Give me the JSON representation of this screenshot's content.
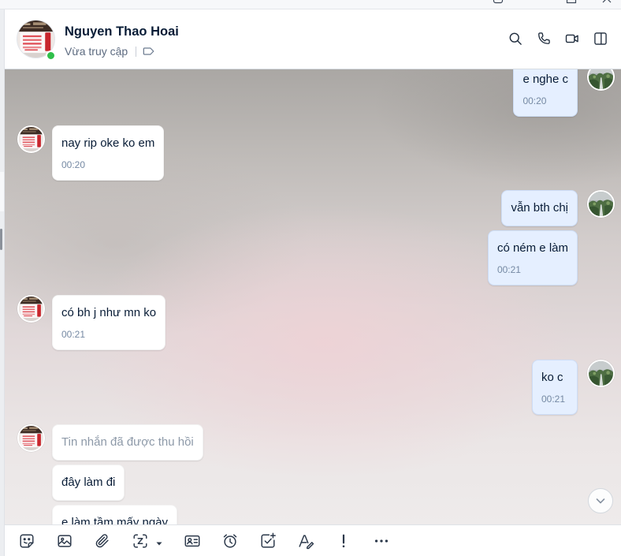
{
  "window": {
    "controls": [
      "window-icon",
      "maximize-icon",
      "close-icon"
    ]
  },
  "header": {
    "name": "Nguyen Thao Hoai",
    "status": "Vừa truy cập",
    "online": true,
    "label_icon": "tag-icon",
    "actions": [
      "search-icon",
      "phone-icon",
      "video-call-icon",
      "sidebar-toggle-icon"
    ]
  },
  "messages": [
    {
      "outgoing": true,
      "text": "e nghe c",
      "time": "00:20"
    },
    {
      "outgoing": false,
      "text": "nay rip oke ko em",
      "time": "00:20"
    },
    {
      "outgoing": true,
      "text": "vẫn bth chị"
    },
    {
      "outgoing": true,
      "text": "có ném e làm",
      "time": "00:21"
    },
    {
      "outgoing": false,
      "text": "có bh j như mn ko",
      "time": "00:21"
    },
    {
      "outgoing": true,
      "text": "ko c",
      "time": "00:21"
    },
    {
      "outgoing": false,
      "text": "Tin nhắn đã được thu hồi",
      "recalled": true
    },
    {
      "outgoing": false,
      "text": "đây làm đi"
    },
    {
      "outgoing": false,
      "text": "e làm tầm mấy ngày"
    }
  ],
  "scroll_down_icon": "chevron-down-icon",
  "composer_toolbar": [
    "sticker-icon",
    "image-icon",
    "attachment-icon",
    "screenshot-icon",
    "dropdown-caret-icon",
    "contact-card-icon",
    "reminder-clock-icon",
    "task-icon",
    "text-format-icon",
    "urgent-icon",
    "more-icon"
  ],
  "colors": {
    "sent_bubble": "#e5efff",
    "received_bubble": "#ffffff",
    "text": "#081c36",
    "time": "#7589a3",
    "recalled_text": "#8d99a8",
    "online": "#2fbf4a"
  }
}
